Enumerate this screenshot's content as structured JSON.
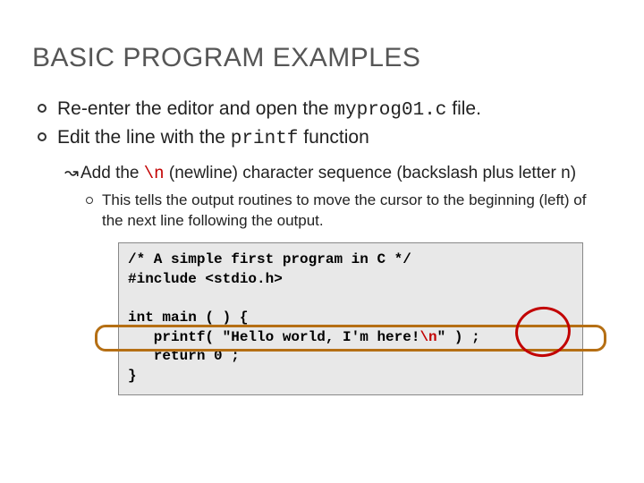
{
  "title": "BASIC PROGRAM EXAMPLES",
  "bullets": {
    "l1a_pre": "Re-enter the editor and open the ",
    "l1a_code": "myprog01.c",
    "l1a_post": " file.",
    "l1b_pre": "Edit the line with the ",
    "l1b_code": "printf",
    "l1b_post": " function"
  },
  "sub": {
    "arrow": "↝",
    "pre": "Add the ",
    "code": "\\n",
    "post": " (newline) character sequence (backslash plus letter n)"
  },
  "subsub": {
    "text": "This tells the output routines to move the cursor to the beginning (left) of the next line following the output."
  },
  "code": {
    "l1": "/* A simple first program in C */",
    "l2": "#include <stdio.h>",
    "l3": "",
    "l4": "int main ( ) {",
    "l5a": "   printf( \"Hello world, I'm here!",
    "l5b": "\\n",
    "l5c": "\" ) ;",
    "l6": "   return 0 ;",
    "l7": "}"
  }
}
